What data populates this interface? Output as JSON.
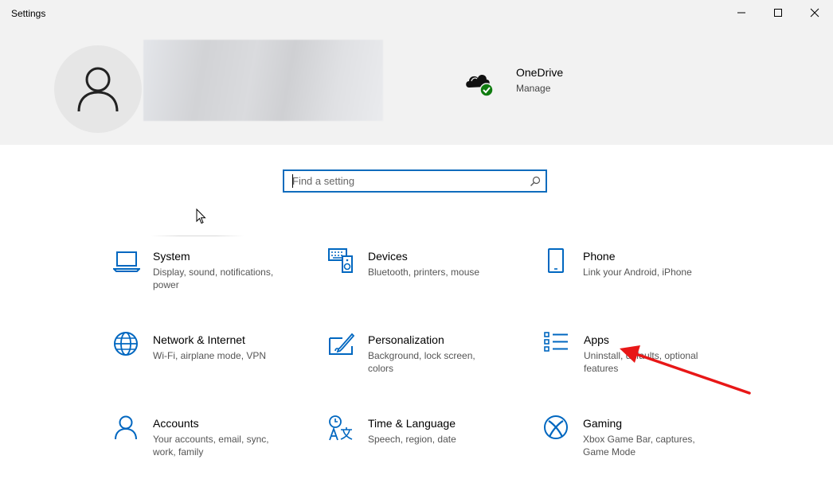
{
  "window": {
    "title": "Settings",
    "controls": {
      "minimize": "minimize-icon",
      "maximize": "maximize-icon",
      "close": "close-icon"
    }
  },
  "account": {
    "avatar_icon": "person-icon"
  },
  "onedrive": {
    "icon": "onedrive-cloud-check-icon",
    "title": "OneDrive",
    "action": "Manage"
  },
  "search": {
    "placeholder": "Find a setting",
    "value": "",
    "icon": "search-icon"
  },
  "tiles": [
    {
      "icon": "laptop-icon",
      "title": "System",
      "desc": "Display, sound, notifications, power"
    },
    {
      "icon": "keyboard-speaker-icon",
      "title": "Devices",
      "desc": "Bluetooth, printers, mouse"
    },
    {
      "icon": "phone-icon",
      "title": "Phone",
      "desc": "Link your Android, iPhone"
    },
    {
      "icon": "globe-icon",
      "title": "Network & Internet",
      "desc": "Wi-Fi, airplane mode, VPN"
    },
    {
      "icon": "paint-brush-icon",
      "title": "Personalization",
      "desc": "Background, lock screen, colors"
    },
    {
      "icon": "apps-list-icon",
      "title": "Apps",
      "desc": "Uninstall, defaults, optional features"
    },
    {
      "icon": "person-icon",
      "title": "Accounts",
      "desc": "Your accounts, email, sync, work, family"
    },
    {
      "icon": "time-language-icon",
      "title": "Time & Language",
      "desc": "Speech, region, date"
    },
    {
      "icon": "xbox-icon",
      "title": "Gaming",
      "desc": "Xbox Game Bar, captures, Game Mode"
    }
  ],
  "colors": {
    "accent": "#0f6cbd",
    "icon_blue": "#0067c0",
    "header_bg": "#f2f2f2",
    "annotation_arrow": "#e81717",
    "onedrive_check": "#107c10"
  }
}
